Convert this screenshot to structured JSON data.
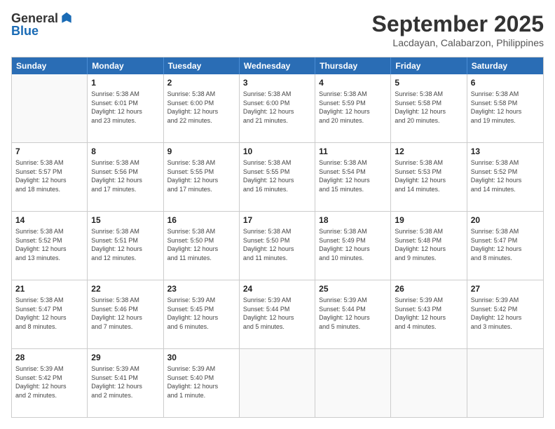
{
  "header": {
    "logo_line1": "General",
    "logo_line2": "Blue",
    "month_title": "September 2025",
    "subtitle": "Lacdayan, Calabarzon, Philippines"
  },
  "weekdays": [
    "Sunday",
    "Monday",
    "Tuesday",
    "Wednesday",
    "Thursday",
    "Friday",
    "Saturday"
  ],
  "weeks": [
    [
      {
        "day": "",
        "empty": true
      },
      {
        "day": "1",
        "line1": "Sunrise: 5:38 AM",
        "line2": "Sunset: 6:01 PM",
        "line3": "Daylight: 12 hours",
        "line4": "and 23 minutes."
      },
      {
        "day": "2",
        "line1": "Sunrise: 5:38 AM",
        "line2": "Sunset: 6:00 PM",
        "line3": "Daylight: 12 hours",
        "line4": "and 22 minutes."
      },
      {
        "day": "3",
        "line1": "Sunrise: 5:38 AM",
        "line2": "Sunset: 6:00 PM",
        "line3": "Daylight: 12 hours",
        "line4": "and 21 minutes."
      },
      {
        "day": "4",
        "line1": "Sunrise: 5:38 AM",
        "line2": "Sunset: 5:59 PM",
        "line3": "Daylight: 12 hours",
        "line4": "and 20 minutes."
      },
      {
        "day": "5",
        "line1": "Sunrise: 5:38 AM",
        "line2": "Sunset: 5:58 PM",
        "line3": "Daylight: 12 hours",
        "line4": "and 20 minutes."
      },
      {
        "day": "6",
        "line1": "Sunrise: 5:38 AM",
        "line2": "Sunset: 5:58 PM",
        "line3": "Daylight: 12 hours",
        "line4": "and 19 minutes."
      }
    ],
    [
      {
        "day": "7",
        "line1": "Sunrise: 5:38 AM",
        "line2": "Sunset: 5:57 PM",
        "line3": "Daylight: 12 hours",
        "line4": "and 18 minutes."
      },
      {
        "day": "8",
        "line1": "Sunrise: 5:38 AM",
        "line2": "Sunset: 5:56 PM",
        "line3": "Daylight: 12 hours",
        "line4": "and 17 minutes."
      },
      {
        "day": "9",
        "line1": "Sunrise: 5:38 AM",
        "line2": "Sunset: 5:55 PM",
        "line3": "Daylight: 12 hours",
        "line4": "and 17 minutes."
      },
      {
        "day": "10",
        "line1": "Sunrise: 5:38 AM",
        "line2": "Sunset: 5:55 PM",
        "line3": "Daylight: 12 hours",
        "line4": "and 16 minutes."
      },
      {
        "day": "11",
        "line1": "Sunrise: 5:38 AM",
        "line2": "Sunset: 5:54 PM",
        "line3": "Daylight: 12 hours",
        "line4": "and 15 minutes."
      },
      {
        "day": "12",
        "line1": "Sunrise: 5:38 AM",
        "line2": "Sunset: 5:53 PM",
        "line3": "Daylight: 12 hours",
        "line4": "and 14 minutes."
      },
      {
        "day": "13",
        "line1": "Sunrise: 5:38 AM",
        "line2": "Sunset: 5:52 PM",
        "line3": "Daylight: 12 hours",
        "line4": "and 14 minutes."
      }
    ],
    [
      {
        "day": "14",
        "line1": "Sunrise: 5:38 AM",
        "line2": "Sunset: 5:52 PM",
        "line3": "Daylight: 12 hours",
        "line4": "and 13 minutes."
      },
      {
        "day": "15",
        "line1": "Sunrise: 5:38 AM",
        "line2": "Sunset: 5:51 PM",
        "line3": "Daylight: 12 hours",
        "line4": "and 12 minutes."
      },
      {
        "day": "16",
        "line1": "Sunrise: 5:38 AM",
        "line2": "Sunset: 5:50 PM",
        "line3": "Daylight: 12 hours",
        "line4": "and 11 minutes."
      },
      {
        "day": "17",
        "line1": "Sunrise: 5:38 AM",
        "line2": "Sunset: 5:50 PM",
        "line3": "Daylight: 12 hours",
        "line4": "and 11 minutes."
      },
      {
        "day": "18",
        "line1": "Sunrise: 5:38 AM",
        "line2": "Sunset: 5:49 PM",
        "line3": "Daylight: 12 hours",
        "line4": "and 10 minutes."
      },
      {
        "day": "19",
        "line1": "Sunrise: 5:38 AM",
        "line2": "Sunset: 5:48 PM",
        "line3": "Daylight: 12 hours",
        "line4": "and 9 minutes."
      },
      {
        "day": "20",
        "line1": "Sunrise: 5:38 AM",
        "line2": "Sunset: 5:47 PM",
        "line3": "Daylight: 12 hours",
        "line4": "and 8 minutes."
      }
    ],
    [
      {
        "day": "21",
        "line1": "Sunrise: 5:38 AM",
        "line2": "Sunset: 5:47 PM",
        "line3": "Daylight: 12 hours",
        "line4": "and 8 minutes."
      },
      {
        "day": "22",
        "line1": "Sunrise: 5:38 AM",
        "line2": "Sunset: 5:46 PM",
        "line3": "Daylight: 12 hours",
        "line4": "and 7 minutes."
      },
      {
        "day": "23",
        "line1": "Sunrise: 5:39 AM",
        "line2": "Sunset: 5:45 PM",
        "line3": "Daylight: 12 hours",
        "line4": "and 6 minutes."
      },
      {
        "day": "24",
        "line1": "Sunrise: 5:39 AM",
        "line2": "Sunset: 5:44 PM",
        "line3": "Daylight: 12 hours",
        "line4": "and 5 minutes."
      },
      {
        "day": "25",
        "line1": "Sunrise: 5:39 AM",
        "line2": "Sunset: 5:44 PM",
        "line3": "Daylight: 12 hours",
        "line4": "and 5 minutes."
      },
      {
        "day": "26",
        "line1": "Sunrise: 5:39 AM",
        "line2": "Sunset: 5:43 PM",
        "line3": "Daylight: 12 hours",
        "line4": "and 4 minutes."
      },
      {
        "day": "27",
        "line1": "Sunrise: 5:39 AM",
        "line2": "Sunset: 5:42 PM",
        "line3": "Daylight: 12 hours",
        "line4": "and 3 minutes."
      }
    ],
    [
      {
        "day": "28",
        "line1": "Sunrise: 5:39 AM",
        "line2": "Sunset: 5:42 PM",
        "line3": "Daylight: 12 hours",
        "line4": "and 2 minutes."
      },
      {
        "day": "29",
        "line1": "Sunrise: 5:39 AM",
        "line2": "Sunset: 5:41 PM",
        "line3": "Daylight: 12 hours",
        "line4": "and 2 minutes."
      },
      {
        "day": "30",
        "line1": "Sunrise: 5:39 AM",
        "line2": "Sunset: 5:40 PM",
        "line3": "Daylight: 12 hours",
        "line4": "and 1 minute."
      },
      {
        "day": "",
        "empty": true
      },
      {
        "day": "",
        "empty": true
      },
      {
        "day": "",
        "empty": true
      },
      {
        "day": "",
        "empty": true
      }
    ]
  ]
}
